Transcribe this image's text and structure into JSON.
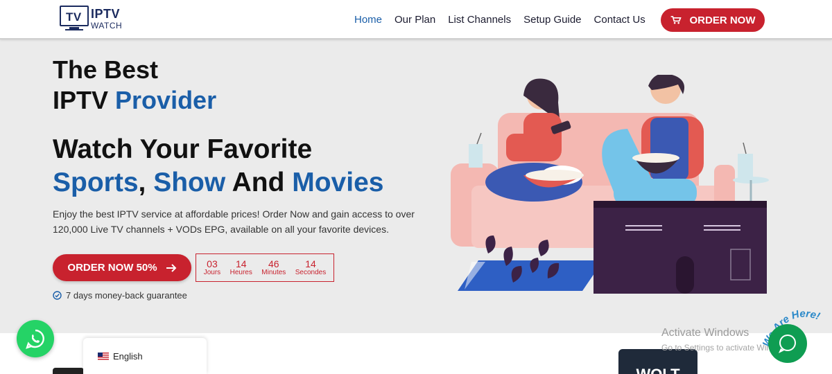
{
  "brand": {
    "logo_tv": "TV",
    "logo_iptv": "IPTV",
    "logo_watch": "WATCH",
    "primary_color": "#1a5ea8",
    "accent_color": "#c8222e"
  },
  "nav": {
    "items": [
      {
        "label": "Home",
        "active": true
      },
      {
        "label": "Our Plan",
        "active": false
      },
      {
        "label": "List Channels",
        "active": false
      },
      {
        "label": "Setup Guide",
        "active": false
      },
      {
        "label": "Contact Us",
        "active": false
      }
    ],
    "order_button": "ORDER NOW",
    "order_icon": "cart-icon"
  },
  "hero": {
    "line1": "The Best",
    "line2_plain": "IPTV ",
    "line2_blue": "Provider",
    "watch_line1": "Watch Your Favorite",
    "watch_sports": "Sports",
    "watch_comma": ", ",
    "watch_show": "Show",
    "watch_and": " And ",
    "watch_movies": "Movies",
    "description": "Enjoy the best IPTV service at affordable prices! Order Now and gain access to over 120,000 Live TV channels + VODs EPG, available on all your favorite devices.",
    "cta_label": "ORDER NOW 50%",
    "cta_icon": "arrow-right-icon",
    "guarantee": "7 days money-back guarantee",
    "guarantee_icon": "check-circle-icon"
  },
  "countdown": [
    {
      "value": "03",
      "label": "Jours"
    },
    {
      "value": "14",
      "label": "Heures"
    },
    {
      "value": "46",
      "label": "Minutes"
    },
    {
      "value": "14",
      "label": "Secondes"
    }
  ],
  "bottom": {
    "language": "English",
    "language_icon": "us-flag-icon",
    "partner_text": "WOLT"
  },
  "widgets": {
    "whatsapp_icon": "whatsapp-icon",
    "chat_icon": "chat-icon",
    "we_are_here": "We Are Here!"
  },
  "os_overlay": {
    "line1": "Activate Windows",
    "line2": "Go to Settings to activate Windows."
  }
}
